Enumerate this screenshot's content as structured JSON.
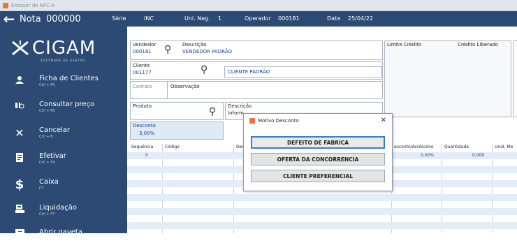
{
  "window": {
    "title": "Emissor de NFC-e"
  },
  "topbar": {
    "title": "Nota",
    "number": "000000",
    "serie_label": "Série",
    "serie_value": "INC",
    "unid_label": "Uni. Neg.",
    "unid_value": "1",
    "operador_label": "Operador",
    "operador_value": "000181",
    "data_label": "Data",
    "data_value": "25/04/22"
  },
  "sidebar": {
    "logo": "CIGAM",
    "logo_sub": "SOFTWARE DE GESTÃO",
    "items": [
      {
        "label": "Ficha de Clientes",
        "key": "Ctrl + F5",
        "icon": "user-icon"
      },
      {
        "label": "Consultar preço",
        "key": "Ctrl + F6",
        "icon": "barcode-search-icon"
      },
      {
        "label": "Cancelar",
        "key": "Ctrl + 8",
        "icon": "close-icon"
      },
      {
        "label": "Efetivar",
        "key": "Ctrl + F4",
        "icon": "document-icon"
      },
      {
        "label": "Caixa",
        "key": "F7",
        "icon": "dollar-icon"
      },
      {
        "label": "Liquidação",
        "key": "Ctrl + F7",
        "icon": "register-icon"
      },
      {
        "label": "Abrir gaveta",
        "key": "",
        "icon": "drawer-icon"
      }
    ]
  },
  "form": {
    "vendedor_label": "Vendedor",
    "vendedor_value": "000181",
    "descricao_label": "Descrição",
    "vendedor_desc": "VENDEDOR PADRÃO",
    "cliente_label": "Cliente",
    "cliente_value": "001177",
    "cliente_desc": "CLIENTE PADRÃO",
    "contato_label": "Contato",
    "observacao_label": "Observação",
    "limite_label": "Limite Crédito",
    "credito_label": "Crédito Liberado",
    "produto_label": "Produto",
    "produto_value": ". .",
    "produto_desc_label": "Descrição",
    "produto_desc_value": "Inform",
    "desconto_label": "Desconto",
    "desconto_value": "3,00%"
  },
  "grid": {
    "headers": [
      "Sequência",
      "Código",
      "Des",
      "esconto/Acréscimo",
      "Quantidade",
      "Unid. Me"
    ],
    "rows": [
      {
        "seq": "0",
        "desconto": "0,00%",
        "quantidade": "0,000"
      }
    ]
  },
  "dialog": {
    "title": "Motivo Desconto",
    "options": [
      "DEFEITO DE FABRICA",
      "OFERTA DA CONCORRENCIA",
      "CLIENTE PREFERENCIAL"
    ]
  },
  "colors": {
    "sidebar": "#2c4a73",
    "accent": "#3a7bd5",
    "value_text": "#1a3f8f"
  }
}
